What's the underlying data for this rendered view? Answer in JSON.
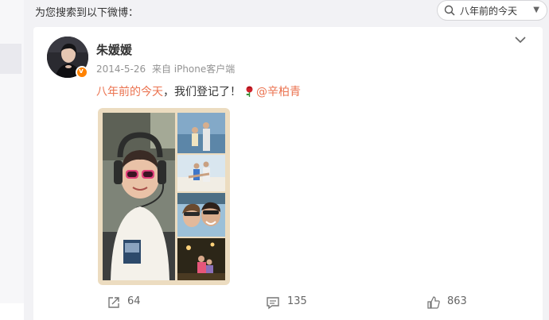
{
  "search": {
    "label": "为您搜索到以下微博：",
    "query": "八年前的今天"
  },
  "post": {
    "username": "朱媛媛",
    "date": "2014-5-26",
    "source": "来自 iPhone客户端",
    "topic": "八年前的今天",
    "text": "，我们登记了！",
    "mention": "@辛柏青"
  },
  "actions": {
    "repost_count": "64",
    "comment_count": "135",
    "like_count": "863"
  },
  "colors": {
    "accent": "#eb7350",
    "verified_badge": "#ff8200",
    "photo_border": "#ecdcc0"
  }
}
